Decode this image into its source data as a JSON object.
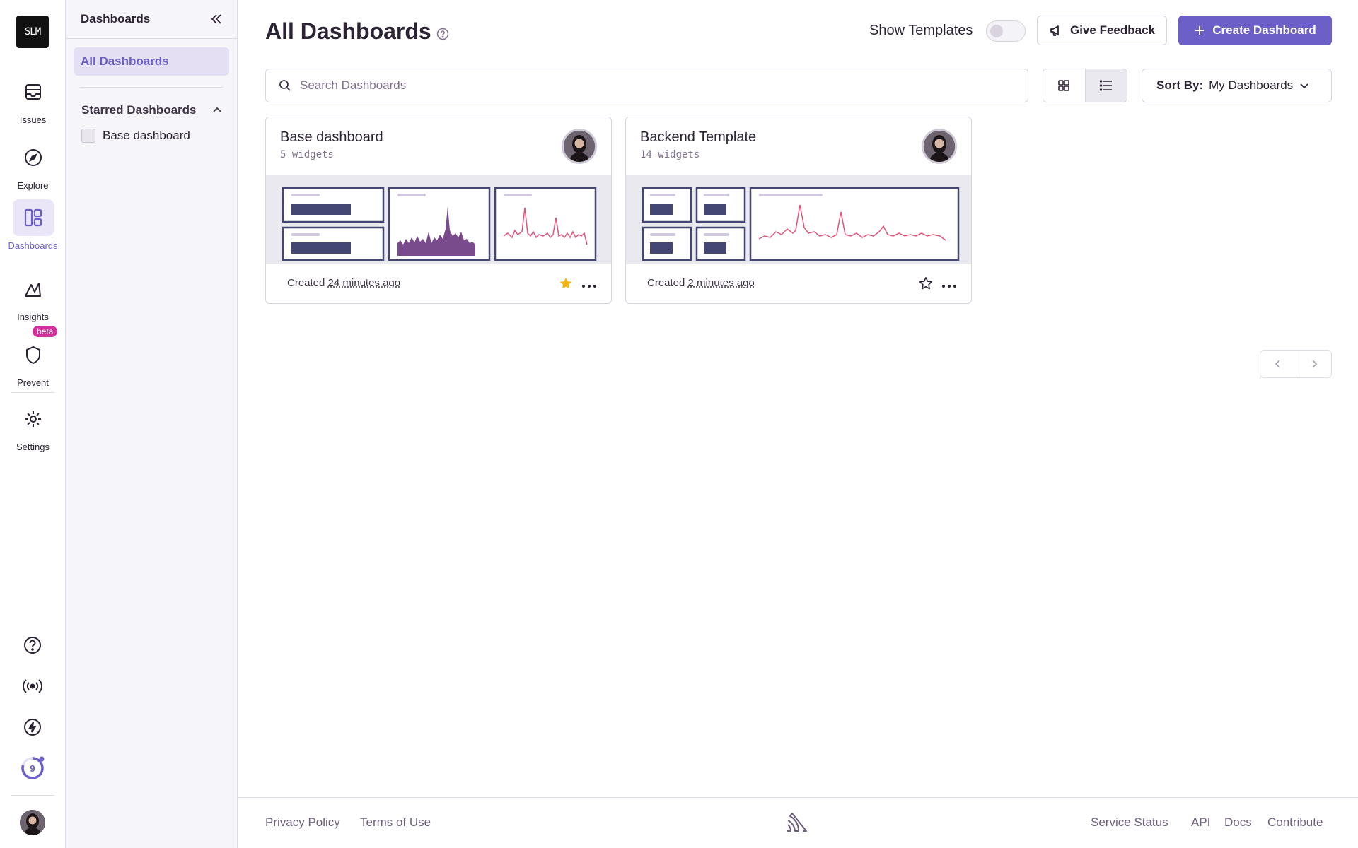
{
  "org": {
    "logo_text": "SLM"
  },
  "nav": {
    "items": [
      {
        "label": "Issues",
        "icon": "issues-icon"
      },
      {
        "label": "Explore",
        "icon": "compass-icon"
      },
      {
        "label": "Dashboards",
        "icon": "dashboards-icon",
        "active": true
      },
      {
        "label": "Insights",
        "icon": "insights-icon"
      },
      {
        "label": "Prevent",
        "icon": "shield-icon",
        "badge": "beta"
      },
      {
        "label": "Settings",
        "icon": "gear-icon"
      }
    ],
    "bottom": {
      "onboarding_count": "9"
    },
    "accent": "#6c5fc7"
  },
  "sidebar": {
    "title": "Dashboards",
    "active_item": "All Dashboards",
    "starred_section": "Starred Dashboards",
    "starred_items": [
      "Base dashboard"
    ]
  },
  "header": {
    "title": "All Dashboards",
    "show_templates_label": "Show Templates",
    "show_templates_enabled": false,
    "feedback_label": "Give Feedback",
    "create_label": "Create Dashboard"
  },
  "filters": {
    "search_placeholder": "Search Dashboards",
    "view_mode": "grid",
    "sort_label": "Sort By:",
    "sort_value": "My Dashboards"
  },
  "dashboards": [
    {
      "title": "Base dashboard",
      "widgets": "5 widgets",
      "created_prefix": "Created",
      "created_ago": "24 minutes ago",
      "starred": true
    },
    {
      "title": "Backend Template",
      "widgets": "14 widgets",
      "created_prefix": "Created",
      "created_ago": "2 minutes ago",
      "starred": false
    }
  ],
  "footer": {
    "left_links": [
      "Privacy Policy",
      "Terms of Use"
    ],
    "right_links": [
      "Service Status",
      "API",
      "Docs",
      "Contribute"
    ]
  },
  "colors": {
    "accent": "#6c5fc7",
    "star": "#f2b712",
    "preview_bar": "#444674",
    "preview_area": "#7a4b8c",
    "preview_line": "#e0557a"
  }
}
